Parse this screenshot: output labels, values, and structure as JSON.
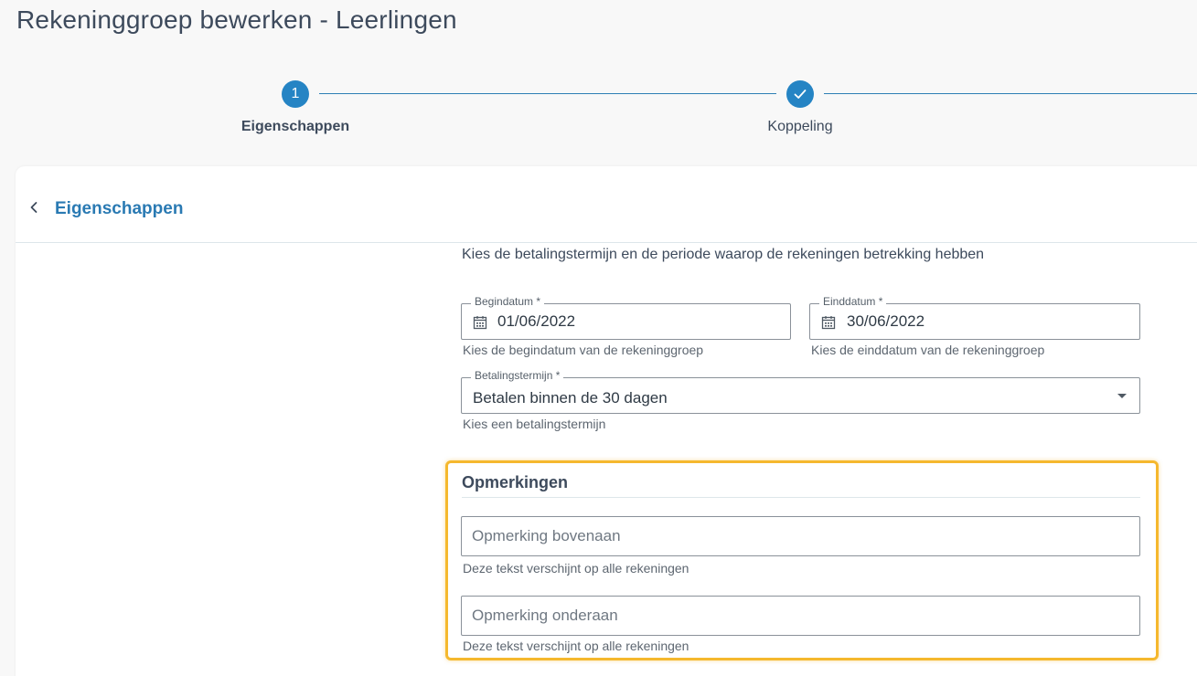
{
  "page": {
    "title": "Rekeninggroep bewerken - Leerlingen"
  },
  "stepper": {
    "steps": [
      {
        "number": "1",
        "label": "Eigenschappen",
        "state": "active"
      },
      {
        "icon": "check-icon",
        "label": "Koppeling",
        "state": "done"
      }
    ]
  },
  "card": {
    "back_icon": "chevron-left-icon",
    "title": "Eigenschappen"
  },
  "form": {
    "intro": "Kies de betalingstermijn en de periode waarop de rekeningen betrekking hebben",
    "start_date": {
      "label": "Begindatum *",
      "value": "01/06/2022",
      "hint": "Kies de begindatum van de rekeninggroep",
      "icon": "calendar-icon"
    },
    "end_date": {
      "label": "Einddatum *",
      "value": "30/06/2022",
      "hint": "Kies de einddatum van de rekeninggroep",
      "icon": "calendar-icon"
    },
    "payment_term": {
      "label": "Betalingstermijn *",
      "value": "Betalen binnen de 30 dagen",
      "hint": "Kies een betalingstermijn",
      "icon": "dropdown-arrow-icon"
    }
  },
  "remarks": {
    "title": "Opmerkingen",
    "top": {
      "placeholder": "Opmerking bovenaan",
      "value": "",
      "hint": "Deze tekst verschijnt op alle rekeningen"
    },
    "bottom": {
      "placeholder": "Opmerking onderaan",
      "value": "",
      "hint": "Deze tekst verschijnt op alle rekeningen"
    }
  },
  "colors": {
    "accent": "#2584c4",
    "highlight": "#f5b82e",
    "title_text": "#3d4a5c"
  }
}
